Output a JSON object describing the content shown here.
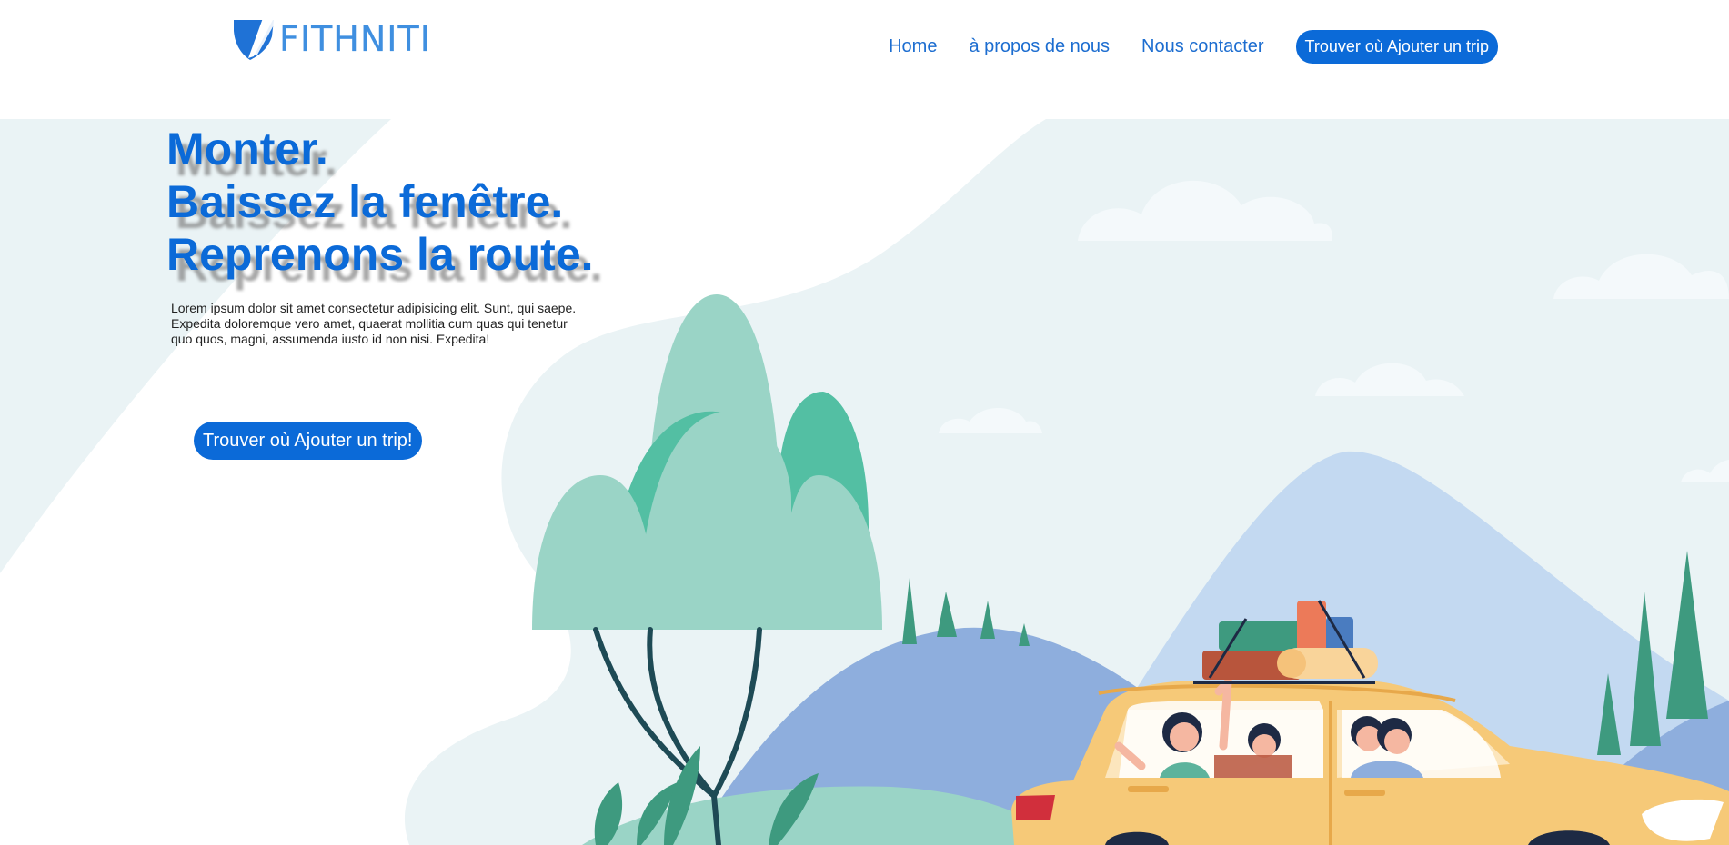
{
  "brand": {
    "name": "FITHNITI",
    "logo_icon": "shield-icon"
  },
  "nav": {
    "items": [
      {
        "label": "Home"
      },
      {
        "label": "à propos de nous"
      },
      {
        "label": "Nous contacter"
      }
    ],
    "cta_label": "Trouver où Ajouter un trip"
  },
  "hero": {
    "headline": [
      "Monter.",
      "Baissez la fenêtre.",
      "Reprenons la route."
    ],
    "lead": "Lorem ipsum dolor sit amet consectetur adipisicing elit. Sunt, qui saepe. Expedita doloremque vero amet, quaerat mollitia cum quas qui tenetur quo quos, magni, assumenda iusto id non nisi. Expedita!",
    "cta_label": "Trouver où Ajouter un trip!"
  },
  "colors": {
    "primary": "#0b6ad8",
    "nav_link": "#1c6dd0",
    "logo": "#3f8fe0",
    "sky": "#eaf3f5",
    "mountain_light": "#c3d9f1",
    "mountain_dark": "#8eaedd",
    "tree_light": "#9ad4c6",
    "tree_dark": "#53bfa3",
    "car": "#f6c978"
  }
}
